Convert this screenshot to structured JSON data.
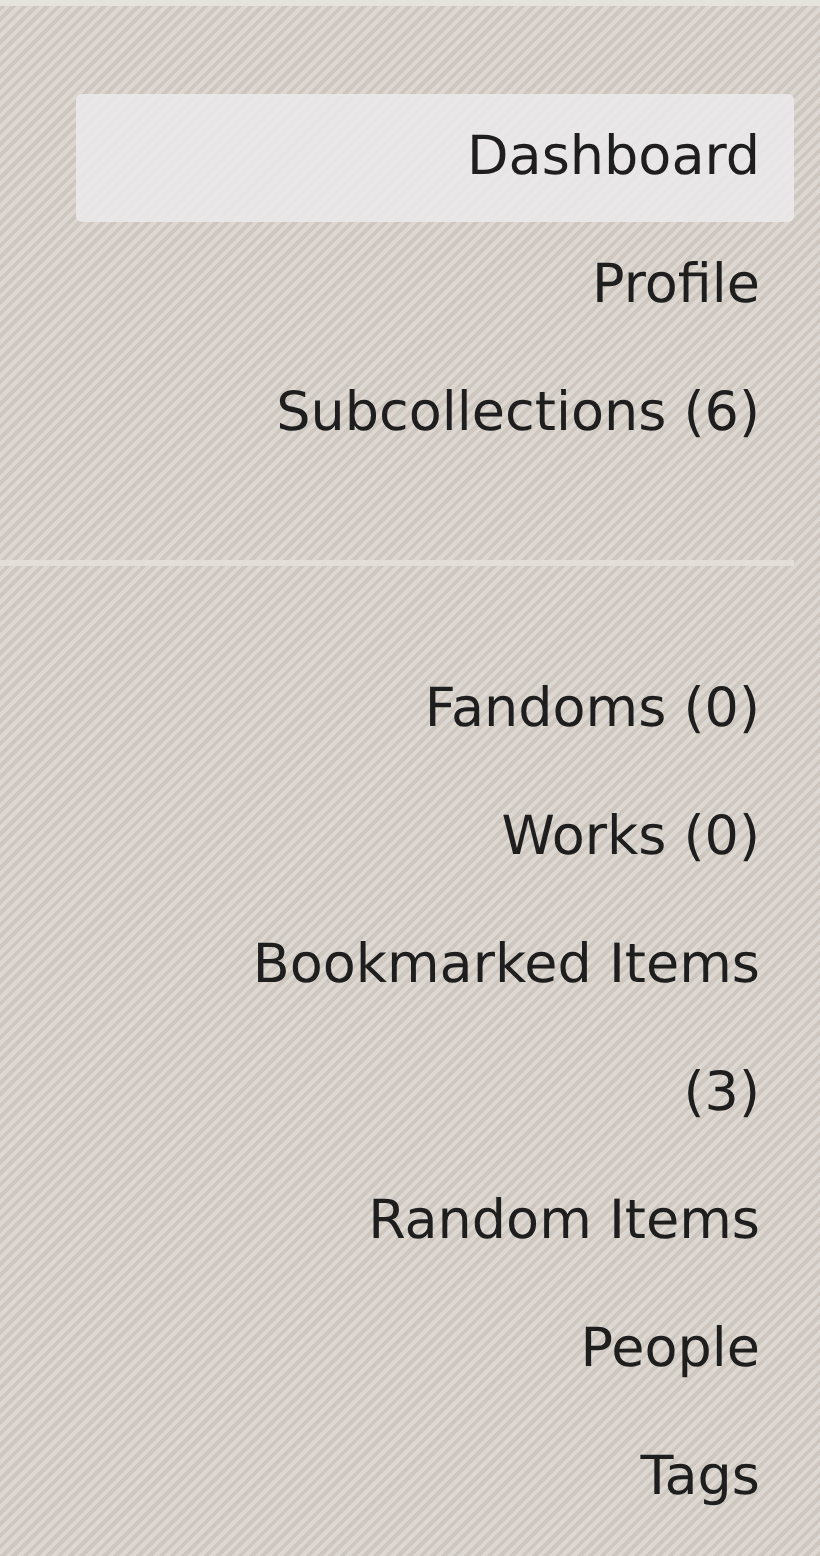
{
  "sections": [
    {
      "items": [
        {
          "label": "Dashboard",
          "selected": true
        },
        {
          "label": "Profile",
          "selected": false
        },
        {
          "label": "Subcollections (6)",
          "selected": false
        }
      ]
    },
    {
      "items": [
        {
          "label": "Fandoms (0)",
          "selected": false
        },
        {
          "label": "Works (0)",
          "selected": false
        },
        {
          "label": "Bookmarked Items (3)",
          "selected": false
        },
        {
          "label": "Random Items",
          "selected": false
        },
        {
          "label": "People",
          "selected": false
        },
        {
          "label": "Tags",
          "selected": false
        }
      ]
    }
  ]
}
